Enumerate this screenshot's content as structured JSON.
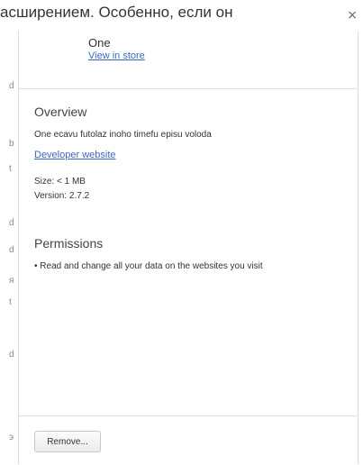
{
  "background": {
    "top_text": "асширением. Особенно, если он",
    "side_letters": [
      "d",
      "b",
      "t",
      "d",
      "d",
      "я",
      "t",
      "d",
      "э"
    ]
  },
  "dialog": {
    "close_glyph": "×",
    "extension_name": "One",
    "view_store_label": "View in store",
    "overview": {
      "title": "Overview",
      "description": "One ecavu futolaz inoho timefu episu voloda",
      "developer_link": "Developer website",
      "size": "Size: < 1 MB",
      "version": "Version: 2.7.2"
    },
    "permissions": {
      "title": "Permissions",
      "items": [
        "• Read and change all your data on the websites you visit"
      ]
    },
    "remove_label": "Remove..."
  }
}
